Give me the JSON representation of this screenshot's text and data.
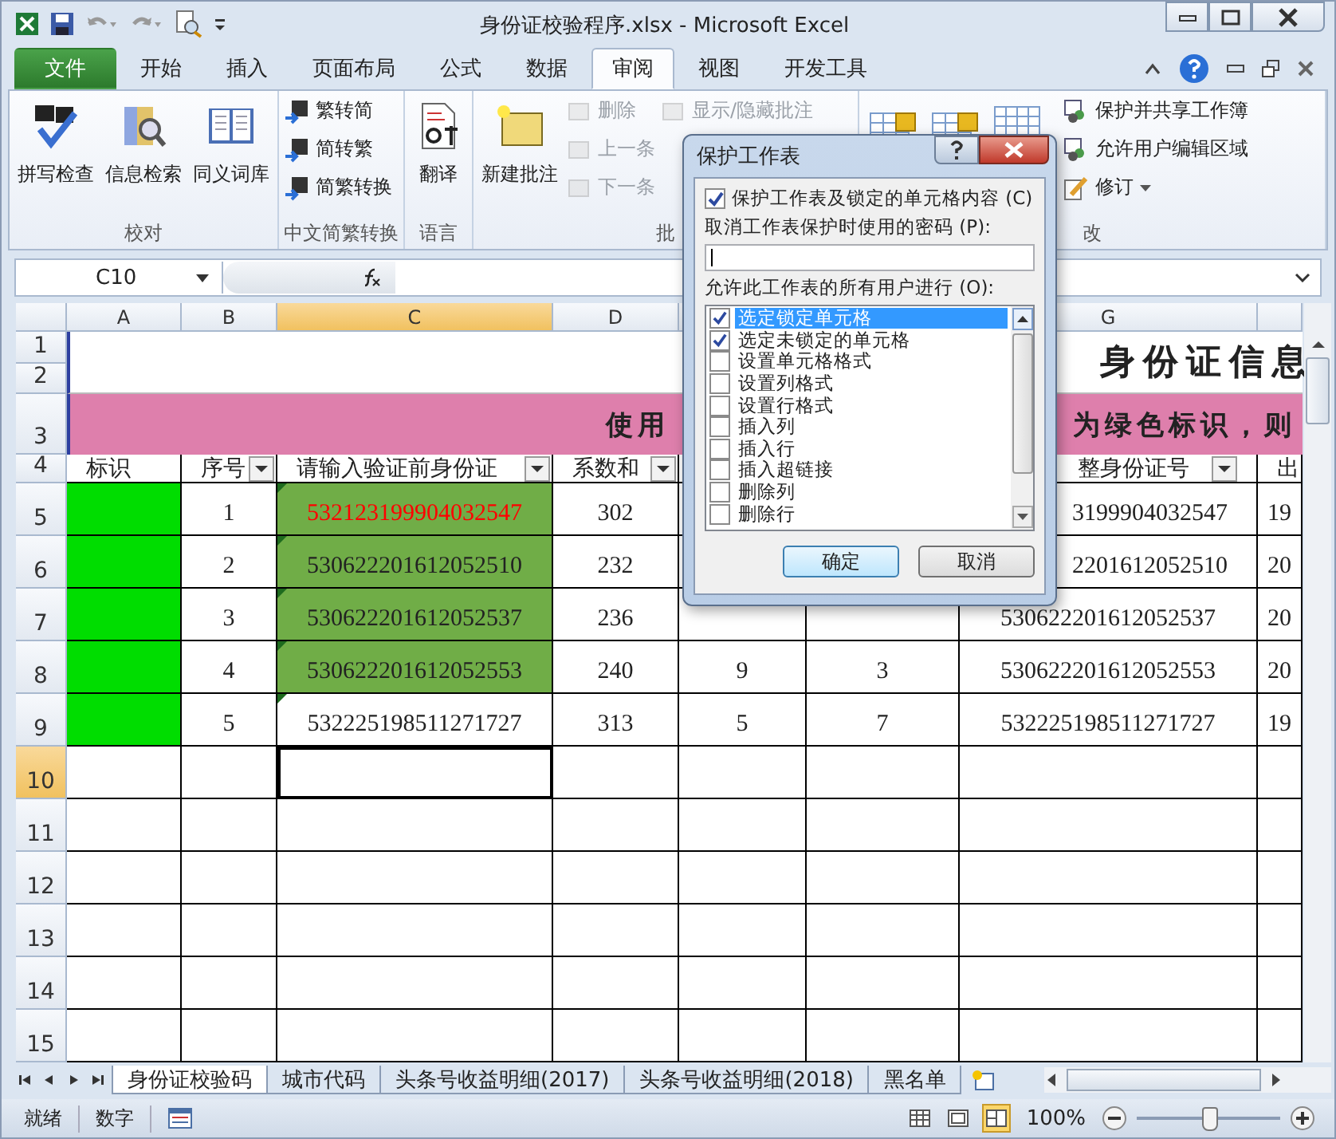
{
  "window": {
    "title": "身份证校验程序.xlsx - Microsoft Excel"
  },
  "ribbon_tabs": [
    {
      "label": "文件",
      "kind": "file",
      "selected": false
    },
    {
      "label": "开始",
      "kind": "tab",
      "selected": false
    },
    {
      "label": "插入",
      "kind": "tab",
      "selected": false
    },
    {
      "label": "页面布局",
      "kind": "tab",
      "selected": false
    },
    {
      "label": "公式",
      "kind": "tab",
      "selected": false
    },
    {
      "label": "数据",
      "kind": "tab",
      "selected": false
    },
    {
      "label": "审阅",
      "kind": "tab",
      "selected": true
    },
    {
      "label": "视图",
      "kind": "tab",
      "selected": false
    },
    {
      "label": "开发工具",
      "kind": "tab",
      "selected": false
    }
  ],
  "ribbon_groups": [
    {
      "label": "校对",
      "columns": [
        [
          {
            "kind": "large",
            "label": "拼写检查",
            "disabled": false
          }
        ],
        [
          {
            "kind": "large",
            "label": "信息检索",
            "disabled": false
          }
        ],
        [
          {
            "kind": "large",
            "label": "同义词库",
            "disabled": false
          }
        ]
      ]
    },
    {
      "label": "中文简繁转换",
      "columns": [
        [
          {
            "kind": "small",
            "label": "繁转简",
            "disabled": false
          },
          {
            "kind": "small",
            "label": "简转繁",
            "disabled": false
          },
          {
            "kind": "small",
            "label": "简繁转换",
            "disabled": false
          }
        ]
      ]
    },
    {
      "label": "语言",
      "columns": [
        [
          {
            "kind": "large",
            "label": "翻译",
            "disabled": false
          }
        ]
      ]
    },
    {
      "label": "批",
      "columns": [
        [
          {
            "kind": "large",
            "label": "新建批注",
            "disabled": false
          }
        ],
        [
          {
            "kind": "small",
            "label": "删除",
            "disabled": true
          },
          {
            "kind": "small",
            "label": "上一条",
            "disabled": true
          },
          {
            "kind": "small",
            "label": "下一条",
            "disabled": true
          }
        ],
        [
          {
            "kind": "small",
            "label": "显示/隐藏批注",
            "disabled": true
          }
        ]
      ]
    },
    {
      "label": "改",
      "columns": [
        [
          {
            "kind": "large",
            "disabled": false
          }
        ],
        [
          {
            "kind": "large",
            "disabled": false
          }
        ],
        [
          {
            "kind": "large",
            "disabled": false
          }
        ],
        [
          {
            "kind": "small",
            "label": "保护并共享工作簿",
            "disabled": false
          },
          {
            "kind": "small",
            "label": "允许用户编辑区域",
            "disabled": false
          },
          {
            "kind": "small",
            "label": "修订",
            "disabled": false,
            "dropdown": true
          }
        ]
      ]
    }
  ],
  "name_box": "C10",
  "columns": [
    {
      "label": "A",
      "selected": false
    },
    {
      "label": "B",
      "selected": false
    },
    {
      "label": "C",
      "selected": true
    },
    {
      "label": "D",
      "selected": false
    },
    null,
    null,
    {
      "label": "G",
      "selected": false
    },
    {
      "selected": false
    }
  ],
  "top_rows": [
    "1",
    "2",
    "3"
  ],
  "sheet_title": "身份证信息",
  "banner": [
    "使用",
    "为绿色标识，则"
  ],
  "rows": [
    {
      "header": "4",
      "selected": false,
      "cells": [
        {
          "text": "标识"
        },
        {
          "text": "序号",
          "filter": true
        },
        {
          "text": "请输入验证前身份证",
          "filter": true
        },
        {
          "text": "系数和",
          "filter": true
        },
        null,
        null,
        {
          "text": "整身份证号",
          "filter": true,
          "cut_left": true
        },
        {
          "text": "出"
        }
      ]
    },
    {
      "header": "5",
      "selected": false,
      "cells": [
        {
          "color": "#00dd00"
        },
        {
          "text": "1"
        },
        {
          "text": "532123199904032547",
          "color": "#70ad47",
          "invalid": true,
          "error_mark": true
        },
        {
          "text": "302"
        },
        null,
        null,
        {
          "text": "3199904032547",
          "cut_left": true
        },
        {
          "text": "19"
        }
      ]
    },
    {
      "header": "6",
      "selected": false,
      "cells": [
        {
          "color": "#00dd00"
        },
        {
          "text": "2"
        },
        {
          "text": "530622201612052510",
          "color": "#70ad47",
          "invalid": false,
          "error_mark": true
        },
        {
          "text": "232"
        },
        null,
        null,
        {
          "text": "2201612052510",
          "cut_left": true
        },
        {
          "text": "20"
        }
      ]
    },
    {
      "header": "7",
      "selected": false,
      "cells": [
        {
          "color": "#00dd00"
        },
        {
          "text": "3"
        },
        {
          "text": "530622201612052537",
          "color": "#70ad47",
          "invalid": false,
          "error_mark": true
        },
        {
          "text": "236"
        },
        null,
        null,
        {
          "text": "530622201612052537"
        },
        {
          "text": "20"
        }
      ]
    },
    {
      "header": "8",
      "selected": false,
      "cells": [
        {
          "color": "#00dd00"
        },
        {
          "text": "4"
        },
        {
          "text": "530622201612052553",
          "color": "#70ad47",
          "invalid": false,
          "error_mark": true
        },
        {
          "text": "240"
        },
        {
          "text": "9"
        },
        {
          "text": "3"
        },
        {
          "text": "530622201612052553"
        },
        {
          "text": "20"
        }
      ]
    },
    {
      "header": "9",
      "selected": false,
      "cells": [
        {
          "color": "#00dd00"
        },
        {
          "text": "5"
        },
        {
          "text": "532225198511271727",
          "invalid": false,
          "error_mark": true
        },
        {
          "text": "313"
        },
        {
          "text": "5"
        },
        {
          "text": "7"
        },
        {
          "text": "532225198511271727"
        },
        {
          "text": "19"
        }
      ]
    },
    {
      "header": "10",
      "selected": true,
      "cells": [
        null,
        null,
        null,
        null,
        null,
        null,
        null,
        null
      ]
    },
    {
      "header": "11",
      "selected": false,
      "cells": [
        null,
        null,
        null,
        null,
        null,
        null,
        null,
        null
      ]
    },
    {
      "header": "12",
      "selected": false,
      "cells": [
        null,
        null,
        null,
        null,
        null,
        null,
        null,
        null
      ]
    },
    {
      "header": "13",
      "selected": false,
      "cells": [
        null,
        null,
        null,
        null,
        null,
        null,
        null,
        null
      ]
    },
    {
      "header": "14",
      "selected": false,
      "cells": [
        null,
        null,
        null,
        null,
        null,
        null,
        null,
        null
      ]
    },
    {
      "header": "15",
      "selected": false,
      "cells": [
        null,
        null,
        null,
        null,
        null,
        null,
        null,
        null
      ]
    }
  ],
  "sheet_tabs": [
    {
      "label": "身份证校验码",
      "selected": true
    },
    {
      "label": "城市代码",
      "selected": false
    },
    {
      "label": "头条号收益明细(2017)",
      "selected": false
    },
    {
      "label": "头条号收益明细(2018)",
      "selected": false
    },
    {
      "label": "黑名单",
      "selected": false
    }
  ],
  "status_bar": {
    "items": [
      "就绪",
      "数字"
    ],
    "views": [
      {
        "selected": false
      },
      {
        "selected": false
      },
      {
        "selected": true
      }
    ],
    "zoom": "100%",
    "zoom_level": {
      "level": 0.5
    }
  },
  "dialog": {
    "title": "保护工作表",
    "protect": {
      "label": "保护工作表及锁定的单元格内容 (C)",
      "checked": true
    },
    "password_label": "取消工作表保护时使用的密码 (P):",
    "allow_label": "允许此工作表的所有用户进行 (O):",
    "options": [
      {
        "label": "选定锁定单元格",
        "checked": true,
        "selected": true
      },
      {
        "label": "选定未锁定的单元格",
        "checked": true,
        "selected": false
      },
      {
        "label": "设置单元格格式",
        "checked": false,
        "selected": false
      },
      {
        "label": "设置列格式",
        "checked": false,
        "selected": false
      },
      {
        "label": "设置行格式",
        "checked": false,
        "selected": false
      },
      {
        "label": "插入列",
        "checked": false,
        "selected": false
      },
      {
        "label": "插入行",
        "checked": false,
        "selected": false
      },
      {
        "label": "插入超链接",
        "checked": false,
        "selected": false
      },
      {
        "label": "删除列",
        "checked": false,
        "selected": false
      },
      {
        "label": "删除行",
        "checked": false,
        "selected": false
      }
    ],
    "buttons": [
      {
        "label": "确定",
        "default": true
      },
      {
        "label": "取消",
        "default": false
      }
    ]
  }
}
